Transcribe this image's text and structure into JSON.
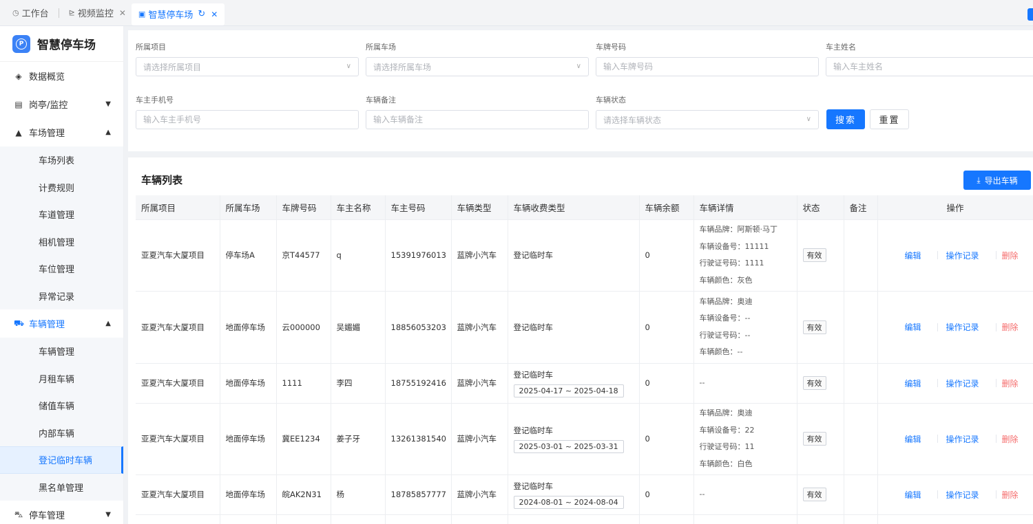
{
  "tabs": [
    {
      "label": "工作台",
      "icon": "dashboard-icon",
      "closable": false
    },
    {
      "label": "视频监控",
      "icon": "camera-icon",
      "closable": true
    },
    {
      "label": "智慧停车场",
      "icon": "parking-icon",
      "closable": true,
      "active": true
    }
  ],
  "brand": {
    "title": "智慧停车场",
    "logo": "P"
  },
  "menu": {
    "overview": "数据概览",
    "booth": "岗亭/监控",
    "lot_mgmt": "车场管理",
    "lot_children": [
      "车场列表",
      "计费规则",
      "车道管理",
      "相机管理",
      "车位管理",
      "异常记录"
    ],
    "vehicle_mgmt": "车辆管理",
    "vehicle_children": [
      "车辆管理",
      "月租车辆",
      "储值车辆",
      "内部车辆",
      "登记临时车辆",
      "黑名单管理"
    ],
    "parking_mgmt": "停车管理"
  },
  "filters": {
    "project": {
      "label": "所属项目",
      "placeholder": "请选择所属项目"
    },
    "lot": {
      "label": "所属车场",
      "placeholder": "请选择所属车场"
    },
    "plate": {
      "label": "车牌号码",
      "placeholder": "输入车牌号码"
    },
    "owner": {
      "label": "车主姓名",
      "placeholder": "输入车主姓名"
    },
    "phone": {
      "label": "车主手机号",
      "placeholder": "输入车主手机号"
    },
    "remark": {
      "label": "车辆备注",
      "placeholder": "输入车辆备注"
    },
    "status": {
      "label": "车辆状态",
      "placeholder": "请选择车辆状态"
    },
    "search_label": "搜索",
    "reset_label": "重置"
  },
  "list": {
    "title": "车辆列表",
    "export_label": "导出车辆",
    "columns": [
      "所属项目",
      "所属车场",
      "车牌号码",
      "车主名称",
      "车主号码",
      "车辆类型",
      "车辆收费类型",
      "车辆余额",
      "车辆详情",
      "状态",
      "备注",
      "操作"
    ],
    "ops": {
      "edit": "编辑",
      "log": "操作记录",
      "delete": "删除"
    },
    "rows": [
      {
        "project": "亚夏汽车大厦项目",
        "lot": "停车场A",
        "plate": "京T44577",
        "owner": "q",
        "phone": "15391976013",
        "type": "蓝牌小汽车",
        "fee_type": "登记临时车",
        "date_range": "",
        "balance": "0",
        "details": [
          "车辆品牌：阿斯顿·马丁",
          "车辆设备号：11111",
          "行驶证号码：1111",
          "车辆颜色：灰色"
        ],
        "status": "有效",
        "remark": ""
      },
      {
        "project": "亚夏汽车大厦项目",
        "lot": "地面停车场",
        "plate": "云000000",
        "owner": "吴媚媚",
        "phone": "18856053203",
        "type": "蓝牌小汽车",
        "fee_type": "登记临时车",
        "date_range": "",
        "balance": "0",
        "details": [
          "车辆品牌：奥迪",
          "车辆设备号：--",
          "行驶证号码：--",
          "车辆颜色：--"
        ],
        "status": "有效",
        "remark": ""
      },
      {
        "project": "亚夏汽车大厦项目",
        "lot": "地面停车场",
        "plate": "1111",
        "owner": "李四",
        "phone": "18755192416",
        "type": "蓝牌小汽车",
        "fee_type": "登记临时车",
        "date_range": "2025-04-17 ~ 2025-04-18",
        "balance": "0",
        "details": [
          "--"
        ],
        "status": "有效",
        "remark": ""
      },
      {
        "project": "亚夏汽车大厦项目",
        "lot": "地面停车场",
        "plate": "冀EE1234",
        "owner": "姜子牙",
        "phone": "13261381540",
        "type": "蓝牌小汽车",
        "fee_type": "登记临时车",
        "date_range": "2025-03-01 ~ 2025-03-31",
        "balance": "0",
        "details": [
          "车辆品牌：奥迪",
          "车辆设备号：22",
          "行驶证号码：11",
          "车辆颜色：白色"
        ],
        "status": "有效",
        "remark": ""
      },
      {
        "project": "亚夏汽车大厦项目",
        "lot": "地面停车场",
        "plate": "皖AK2N31",
        "owner": "杨",
        "phone": "18785857777",
        "type": "蓝牌小汽车",
        "fee_type": "登记临时车",
        "date_range": "2024-08-01 ~ 2024-08-04",
        "balance": "0",
        "details": [
          "--"
        ],
        "status": "有效",
        "remark": ""
      }
    ]
  },
  "colors": {
    "primary": "#1677ff",
    "danger": "#f56c6c",
    "active_bg": "#e6f1ff"
  }
}
